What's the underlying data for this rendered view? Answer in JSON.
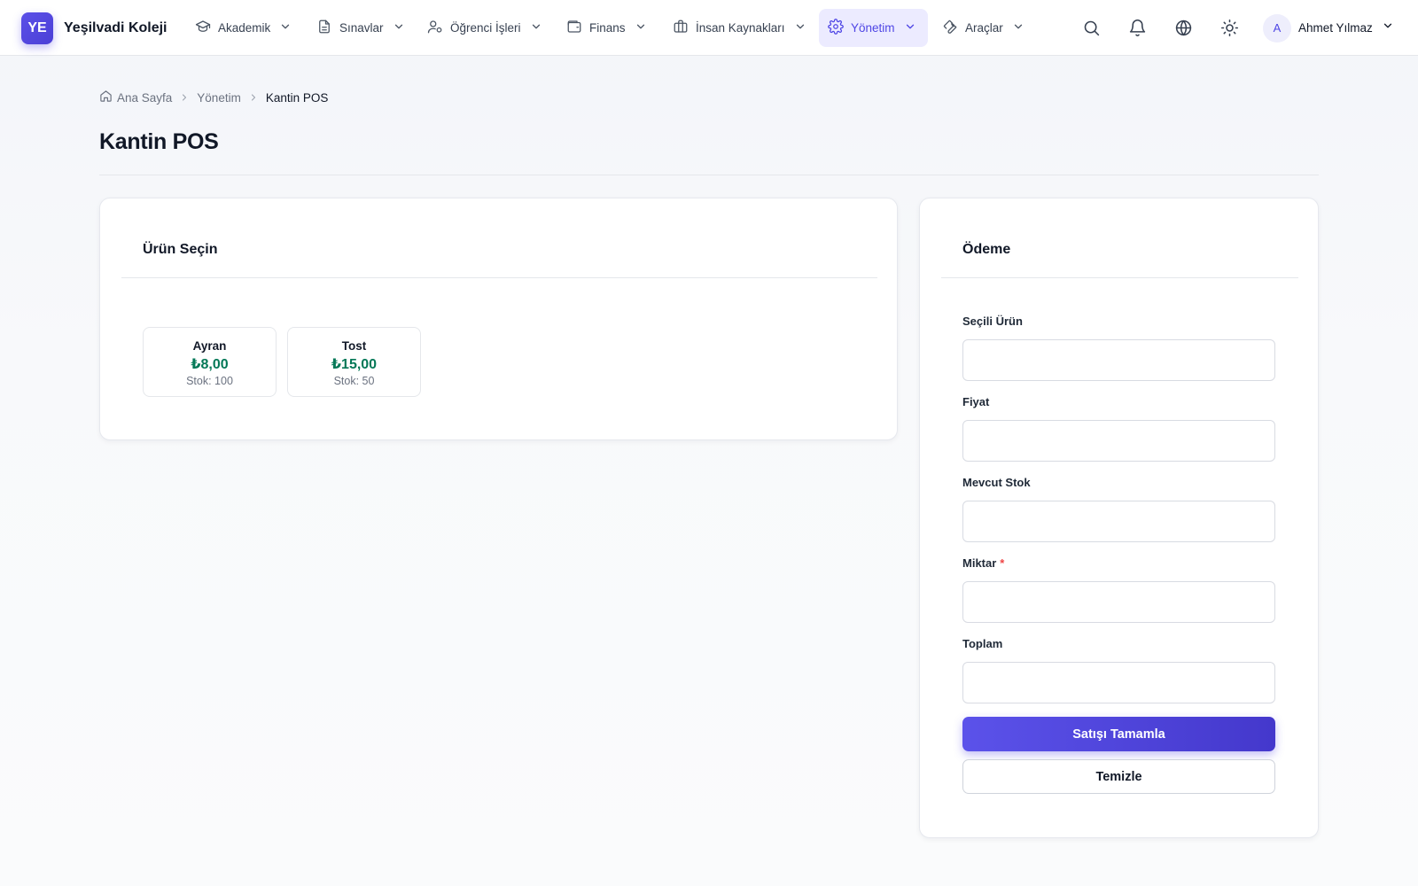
{
  "app": {
    "logo_text": "YE",
    "name": "Yeşilvadi Koleji"
  },
  "nav": {
    "items": [
      {
        "label": "Akademik",
        "icon": "graduation-cap-icon",
        "active": false
      },
      {
        "label": "Sınavlar",
        "icon": "document-icon",
        "active": false
      },
      {
        "label": "Öğrenci İşleri",
        "icon": "user-cog-icon",
        "active": false
      },
      {
        "label": "Finans",
        "icon": "wallet-icon",
        "active": false
      },
      {
        "label": "İnsan Kaynakları",
        "icon": "briefcase-icon",
        "active": false
      },
      {
        "label": "Yönetim",
        "icon": "gear-icon",
        "active": true
      },
      {
        "label": "Araçlar",
        "icon": "wrench-icon",
        "active": false
      }
    ],
    "actions": [
      "search-icon",
      "bell-icon",
      "globe-icon",
      "sun-icon"
    ]
  },
  "user": {
    "avatar_initial": "A",
    "name": "Ahmet Yılmaz"
  },
  "breadcrumb": {
    "home": "Ana Sayfa",
    "section": "Yönetim",
    "current": "Kantin POS"
  },
  "page": {
    "title": "Kantin POS"
  },
  "products_card": {
    "title": "Ürün Seçin",
    "products": [
      {
        "name": "Ayran",
        "price": "₺8,00",
        "stock": "Stok: 100"
      },
      {
        "name": "Tost",
        "price": "₺15,00",
        "stock": "Stok: 50"
      }
    ]
  },
  "payment_card": {
    "title": "Ödeme",
    "fields": {
      "selected_product": {
        "label": "Seçili Ürün",
        "value": ""
      },
      "price": {
        "label": "Fiyat",
        "value": ""
      },
      "stock": {
        "label": "Mevcut Stok",
        "value": ""
      },
      "quantity": {
        "label": "Miktar",
        "required_mark": "*",
        "value": ""
      },
      "total": {
        "label": "Toplam",
        "value": ""
      }
    },
    "complete_button": "Satışı Tamamla",
    "clear_button": "Temizle"
  },
  "colors": {
    "accent": "#4f46e5",
    "price_green": "#047857",
    "required_red": "#ef4444"
  }
}
